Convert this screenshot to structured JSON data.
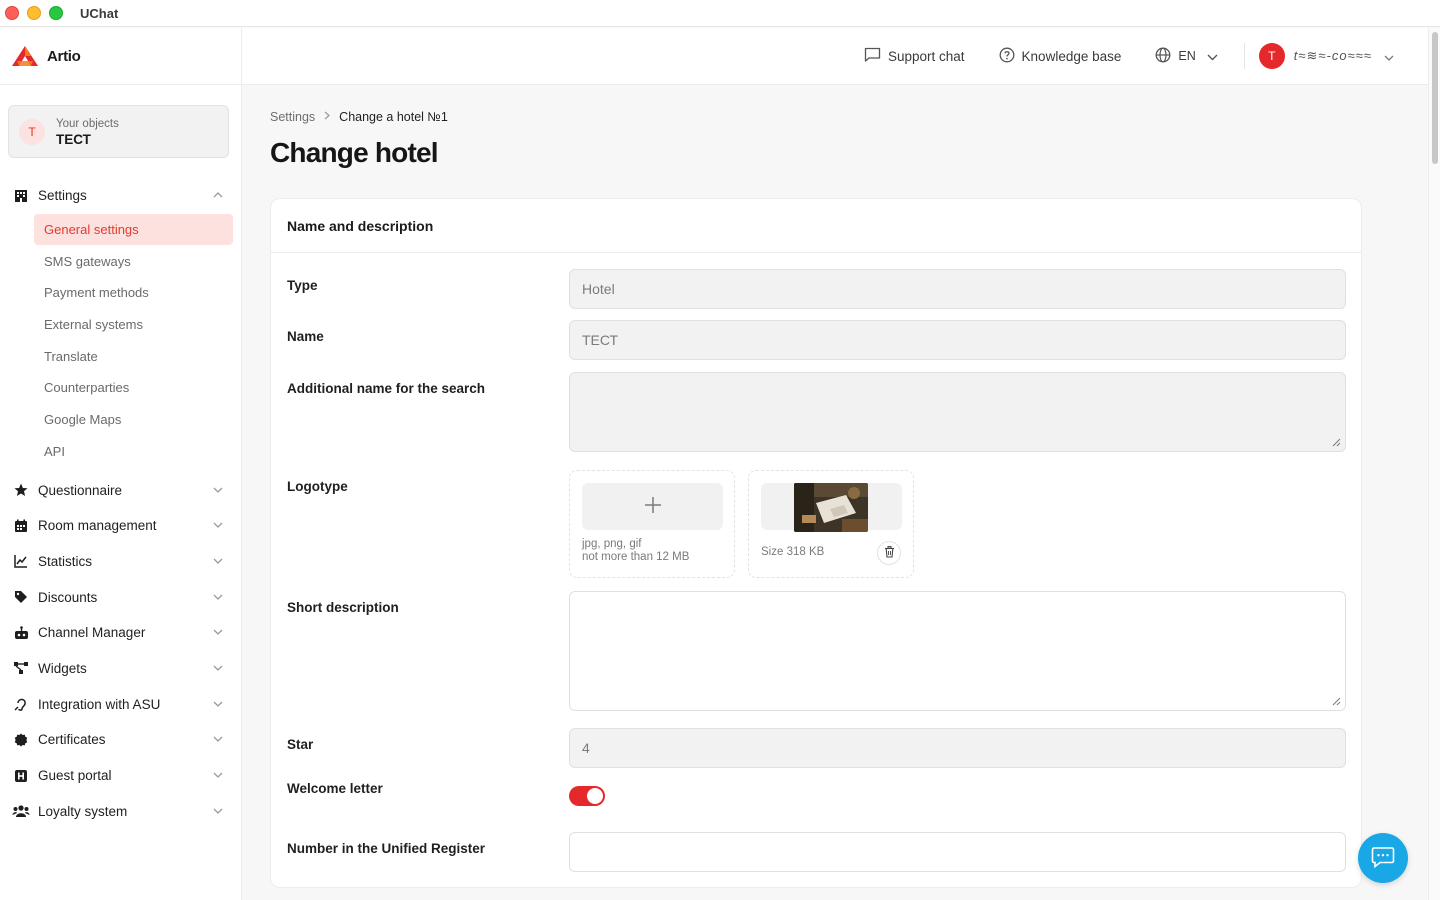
{
  "window": {
    "app_title": "UChat"
  },
  "brand": {
    "name": "Artio",
    "accent": "#e5282a",
    "logo_orange": "#f47b20"
  },
  "objects": {
    "caption": "Your objects",
    "value": "ТЕСТ",
    "avatar_letter": "Т"
  },
  "sidebar": {
    "settings": {
      "label": "Settings",
      "icon": "building-icon",
      "items": [
        {
          "label": "General settings",
          "active": true
        },
        {
          "label": "SMS gateways"
        },
        {
          "label": "Payment methods"
        },
        {
          "label": "External systems"
        },
        {
          "label": "Translate"
        },
        {
          "label": "Counterparties"
        },
        {
          "label": "Google Maps"
        },
        {
          "label": "API"
        }
      ]
    },
    "groups": [
      {
        "label": "Questionnaire",
        "icon": "star-icon"
      },
      {
        "label": "Room management",
        "icon": "calendar-icon"
      },
      {
        "label": "Statistics",
        "icon": "chart-line-icon"
      },
      {
        "label": "Discounts",
        "icon": "tags-icon"
      },
      {
        "label": "Channel Manager",
        "icon": "robot-icon"
      },
      {
        "label": "Widgets",
        "icon": "nodes-icon"
      },
      {
        "label": "Integration with ASU",
        "icon": "ear-icon"
      },
      {
        "label": "Certificates",
        "icon": "badge-icon"
      },
      {
        "label": "Guest portal",
        "icon": "h-square-icon"
      },
      {
        "label": "Loyalty system",
        "icon": "users-icon"
      }
    ]
  },
  "header": {
    "support": "Support chat",
    "knowledge": "Knowledge base",
    "language": "EN",
    "user_avatar_letter": "T",
    "user_name": "t≈≋≈-co≈≈≈"
  },
  "breadcrumb": {
    "root": "Settings",
    "current": "Change a hotel №1"
  },
  "page": {
    "title": "Change hotel"
  },
  "form": {
    "section_title": "Name and description",
    "type": {
      "label": "Type",
      "value": "Hotel"
    },
    "name": {
      "label": "Name",
      "value": "ТЕСТ"
    },
    "additional_name": {
      "label": "Additional name for the search",
      "value": ""
    },
    "logotype": {
      "label": "Logotype",
      "hint_line1": "jpg, png, gif",
      "hint_line2": "not more than 12 MB",
      "size_text": "Size 318 KB"
    },
    "short_description": {
      "label": "Short description",
      "value": ""
    },
    "star": {
      "label": "Star",
      "value": "4"
    },
    "welcome_letter": {
      "label": "Welcome letter",
      "enabled": true
    },
    "unified_register": {
      "label": "Number in the Unified Register",
      "value": ""
    }
  }
}
